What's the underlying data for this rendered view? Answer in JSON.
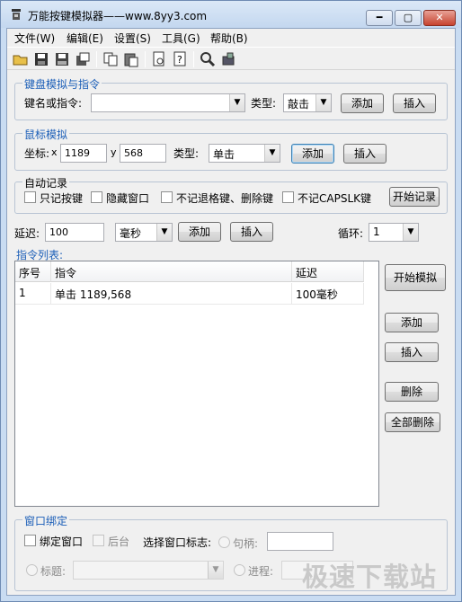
{
  "window": {
    "title": "万能按键模拟器——www.8yy3.com",
    "min_icon": "minimize-icon",
    "max_icon": "maximize-icon",
    "close_icon": "close-icon"
  },
  "menu": [
    "文件(W)",
    "编辑(E)",
    "设置(S)",
    "工具(G)",
    "帮助(B)"
  ],
  "toolbar_icons": [
    "open-folder-icon",
    "save-icon",
    "save-as-icon",
    "export-icon",
    "copy-icon",
    "paste-icon",
    "preview-icon",
    "help-icon",
    "search-icon",
    "tool-icon"
  ],
  "keyboard": {
    "group": "键盘模拟与指令",
    "key_label": "键名或指令:",
    "key_value": "",
    "type_label": "类型:",
    "type_value": "敲击",
    "add": "添加",
    "insert": "插入"
  },
  "mouse": {
    "group": "鼠标模拟",
    "coord_label": "坐标:",
    "x_label": "x",
    "x_value": "1189",
    "y_label": "y",
    "y_value": "568",
    "type_label": "类型:",
    "type_value": "单击",
    "add": "添加",
    "insert": "插入"
  },
  "record": {
    "group": "自动记录",
    "opt1": "只记按键",
    "opt2": "隐藏窗口",
    "opt3": "不记退格键、删除键",
    "opt4": "不记CAPSLK键",
    "start": "开始记录"
  },
  "delay": {
    "label": "延迟:",
    "value": "100",
    "unit": "毫秒",
    "add": "添加",
    "insert": "插入",
    "loop_label": "循环:",
    "loop_value": "1"
  },
  "list": {
    "title": "指令列表:",
    "headers": [
      "序号",
      "指令",
      "延迟"
    ],
    "rows": [
      {
        "no": "1",
        "cmd": "单击 1189,568",
        "delay": "100毫秒"
      }
    ]
  },
  "side_buttons": {
    "start": "开始模拟",
    "add": "添加",
    "insert": "插入",
    "delete": "删除",
    "delete_all": "全部删除"
  },
  "bind": {
    "group": "窗口绑定",
    "bind_window": "绑定窗口",
    "background": "后台",
    "select_label": "选择窗口标志:",
    "handle_label": "句柄:",
    "handle_value": "",
    "title_label": "标题:",
    "process_label": "进程:"
  },
  "watermark": "极速下载站"
}
